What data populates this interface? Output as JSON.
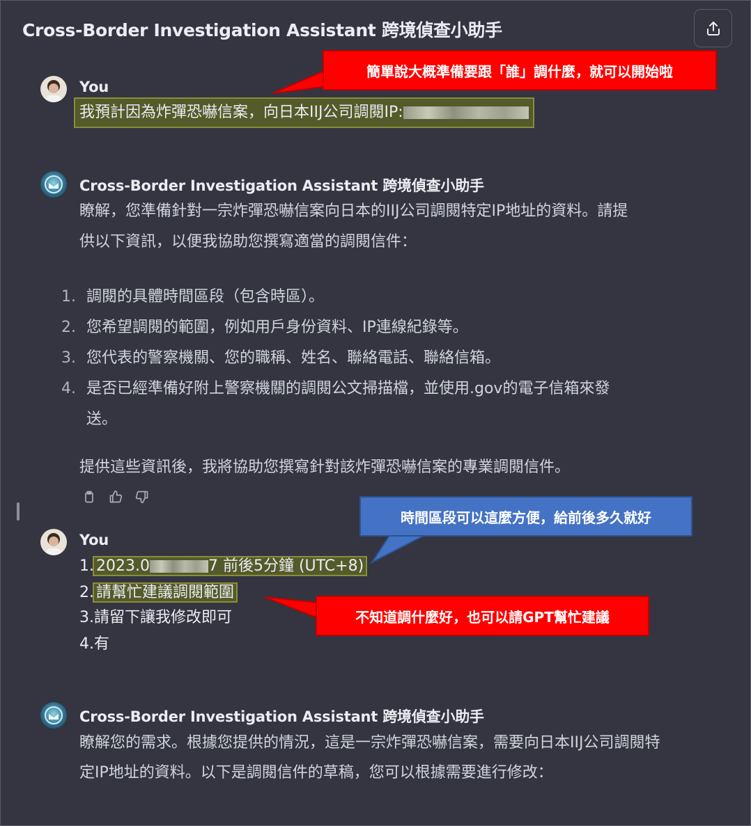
{
  "header": {
    "title": "Cross-Border Investigation Assistant 跨境偵查小助手",
    "chevron": "⌄",
    "share_icon": "share-icon"
  },
  "messages": [
    {
      "author": "You",
      "text_prefix": "我預計因為炸彈恐嚇信案，向日本IIJ公司調閱IP:"
    },
    {
      "author": "Cross-Border Investigation Assistant 跨境偵查小助手",
      "para1_line1": "瞭解，您準備針對一宗炸彈恐嚇信案向日本的IIJ公司調閱特定IP地址的資料。請提",
      "para1_line2": "供以下資訊，以便我協助您撰寫適當的調閱信件：",
      "list": [
        {
          "num": "1.",
          "text": "調閱的具體時間區段（包含時區）。"
        },
        {
          "num": "2.",
          "text": "您希望調閱的範圍，例如用戶身份資料、IP連線紀錄等。"
        },
        {
          "num": "3.",
          "text": "您代表的警察機關、您的職稱、姓名、聯絡電話、聯絡信箱。"
        },
        {
          "num": "4.",
          "text": "是否已經準備好附上警察機關的調閱公文掃描檔，並使用.gov的電子信箱來發",
          "cont": "送。"
        }
      ],
      "closing": "提供這些資訊後，我將協助您撰寫針對該炸彈恐嚇信案的專業調閱信件。"
    },
    {
      "author": "You",
      "lines": [
        {
          "num": "1.",
          "a": "2023.0",
          "b": "7 前後5分鐘 (UTC+8)"
        },
        {
          "num": "2.",
          "text": "請幫忙建議調閱範圍"
        },
        {
          "num": "3.",
          "text": "請留下讓我修改即可"
        },
        {
          "num": "4.",
          "text": "有"
        }
      ]
    },
    {
      "author": "Cross-Border Investigation Assistant 跨境偵查小助手",
      "line1": "瞭解您的需求。根據您提供的情況，這是一宗炸彈恐嚇信案，需要向日本IIJ公司調閱特",
      "line2": "定IP地址的資料。以下是調閱信件的草稿，您可以根據需要進行修改："
    }
  ],
  "callouts": [
    {
      "text": "簡單說大概準備要跟「誰」調什麼，就可以開始啦",
      "color": "#ff0000"
    },
    {
      "text": "時間區段可以這麼方便，給前後多久就好",
      "color": "#4472c4"
    },
    {
      "text": "不知道調什麼好，也可以請GPT幫忙建議",
      "color": "#ff0000"
    }
  ],
  "action_icons": [
    "copy-icon",
    "thumbs-up-icon",
    "thumbs-down-icon"
  ]
}
